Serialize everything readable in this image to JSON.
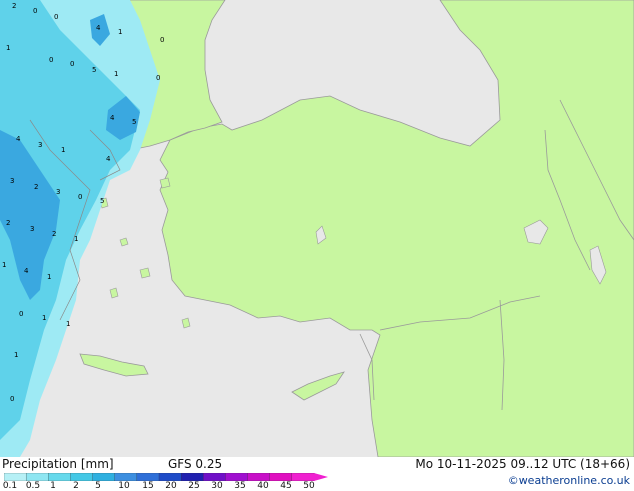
{
  "footer": {
    "title": "Precipitation [mm]",
    "model": "GFS 0.25",
    "valid": "Mo 10-11-2025 09..12 UTC (18+66)",
    "credit": "©weatheronline.co.uk"
  },
  "legend": {
    "ticks": [
      "0.1",
      "0.5",
      "1",
      "2",
      "5",
      "10",
      "15",
      "20",
      "25",
      "30",
      "35",
      "40",
      "45",
      "50"
    ],
    "colors": [
      "#b6f0f6",
      "#8fe6f2",
      "#66d9ec",
      "#44c8e6",
      "#2fb0e0",
      "#3d8fe0",
      "#2f6fd8",
      "#1f4cc8",
      "#2020b0",
      "#7010c8",
      "#a010d0",
      "#c810c8",
      "#e010c0",
      "#f020d0"
    ]
  },
  "map_colors": {
    "sea": "#e8e8e8",
    "land": "#c8f6a0",
    "border": "#9a9a9a",
    "precip_light": "#9eeaf4",
    "precip_mid": "#5fd2ea",
    "precip_heavy": "#3aa8e0"
  },
  "precip_labels": [
    {
      "id": "lbl-1",
      "text": "2"
    },
    {
      "id": "lbl-2",
      "text": "0"
    },
    {
      "id": "lbl-3",
      "text": "0"
    },
    {
      "id": "lbl-4",
      "text": "4"
    },
    {
      "id": "lbl-5",
      "text": "1"
    },
    {
      "id": "lbl-6",
      "text": "0"
    },
    {
      "id": "lbl-7",
      "text": "1"
    },
    {
      "id": "lbl-8",
      "text": "0"
    },
    {
      "id": "lbl-9",
      "text": "0"
    },
    {
      "id": "lbl-10",
      "text": "5"
    },
    {
      "id": "lbl-11",
      "text": "1"
    },
    {
      "id": "lbl-12",
      "text": "0"
    },
    {
      "id": "lbl-13",
      "text": "4"
    },
    {
      "id": "lbl-14",
      "text": "5"
    },
    {
      "id": "lbl-15",
      "text": "4"
    },
    {
      "id": "lbl-16",
      "text": "3"
    },
    {
      "id": "lbl-17",
      "text": "1"
    },
    {
      "id": "lbl-18",
      "text": "4"
    },
    {
      "id": "lbl-19",
      "text": "3"
    },
    {
      "id": "lbl-20",
      "text": "2"
    },
    {
      "id": "lbl-21",
      "text": "3"
    },
    {
      "id": "lbl-22",
      "text": "0"
    },
    {
      "id": "lbl-23",
      "text": "5"
    },
    {
      "id": "lbl-24",
      "text": "2"
    },
    {
      "id": "lbl-25",
      "text": "3"
    },
    {
      "id": "lbl-26",
      "text": "2"
    },
    {
      "id": "lbl-27",
      "text": "1"
    },
    {
      "id": "lbl-28",
      "text": "1"
    },
    {
      "id": "lbl-29",
      "text": "4"
    },
    {
      "id": "lbl-30",
      "text": "1"
    },
    {
      "id": "lbl-31",
      "text": "0"
    },
    {
      "id": "lbl-32",
      "text": "1"
    },
    {
      "id": "lbl-33",
      "text": "1"
    },
    {
      "id": "lbl-34",
      "text": "1"
    },
    {
      "id": "lbl-35",
      "text": "0"
    }
  ]
}
